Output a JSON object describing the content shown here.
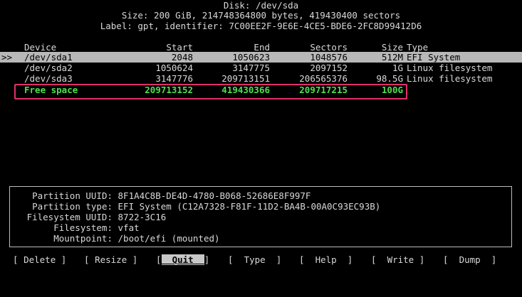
{
  "disk": {
    "title": "Disk: /dev/sda",
    "size_line": "Size: 200 GiB, 214748364800 bytes, 419430400 sectors",
    "label_line": "Label: gpt, identifier: 7C00EE2F-9E6E-4CE5-BDE6-2FC8D99412D6"
  },
  "table": {
    "headers": {
      "device": "Device",
      "start": "Start",
      "end": "End",
      "sectors": "Sectors",
      "size": "Size",
      "type": "Type"
    },
    "rows": [
      {
        "marker": ">>",
        "device": "/dev/sda1",
        "start": "2048",
        "end": "1050623",
        "sectors": "1048576",
        "size": "512M",
        "type": "EFI System"
      },
      {
        "marker": "",
        "device": "/dev/sda2",
        "start": "1050624",
        "end": "3147775",
        "sectors": "2097152",
        "size": "1G",
        "type": "Linux filesystem"
      },
      {
        "marker": "",
        "device": "/dev/sda3",
        "start": "3147776",
        "end": "209713151",
        "sectors": "206565376",
        "size": "98.5G",
        "type": "Linux filesystem"
      },
      {
        "marker": "",
        "device": "Free space",
        "start": "209713152",
        "end": "419430366",
        "sectors": "209717215",
        "size": "100G",
        "type": ""
      }
    ]
  },
  "info": {
    "partition_uuid_label": "Partition UUID:",
    "partition_uuid": "8F1A4C8B-DE4D-4780-B068-52686E8F997F",
    "partition_type_label": "Partition type:",
    "partition_type": "EFI System (C12A7328-F81F-11D2-BA4B-00A0C93EC93B)",
    "fs_uuid_label": "Filesystem UUID:",
    "fs_uuid": "8722-3C16",
    "filesystem_label": "Filesystem:",
    "filesystem": "vfat",
    "mountpoint_label": "Mountpoint:",
    "mountpoint": "/boot/efi (mounted)"
  },
  "menu": {
    "delete": "Delete",
    "resize": "Resize",
    "quit": "Quit",
    "type": "Type",
    "help": "Help",
    "write": "Write",
    "dump": "Dump"
  },
  "colors": {
    "background": "#000000",
    "text": "#d8d8d8",
    "selected_row": "#b8b8b8",
    "free_space": "#4ee04e",
    "highlight_box": "#e0306a"
  }
}
